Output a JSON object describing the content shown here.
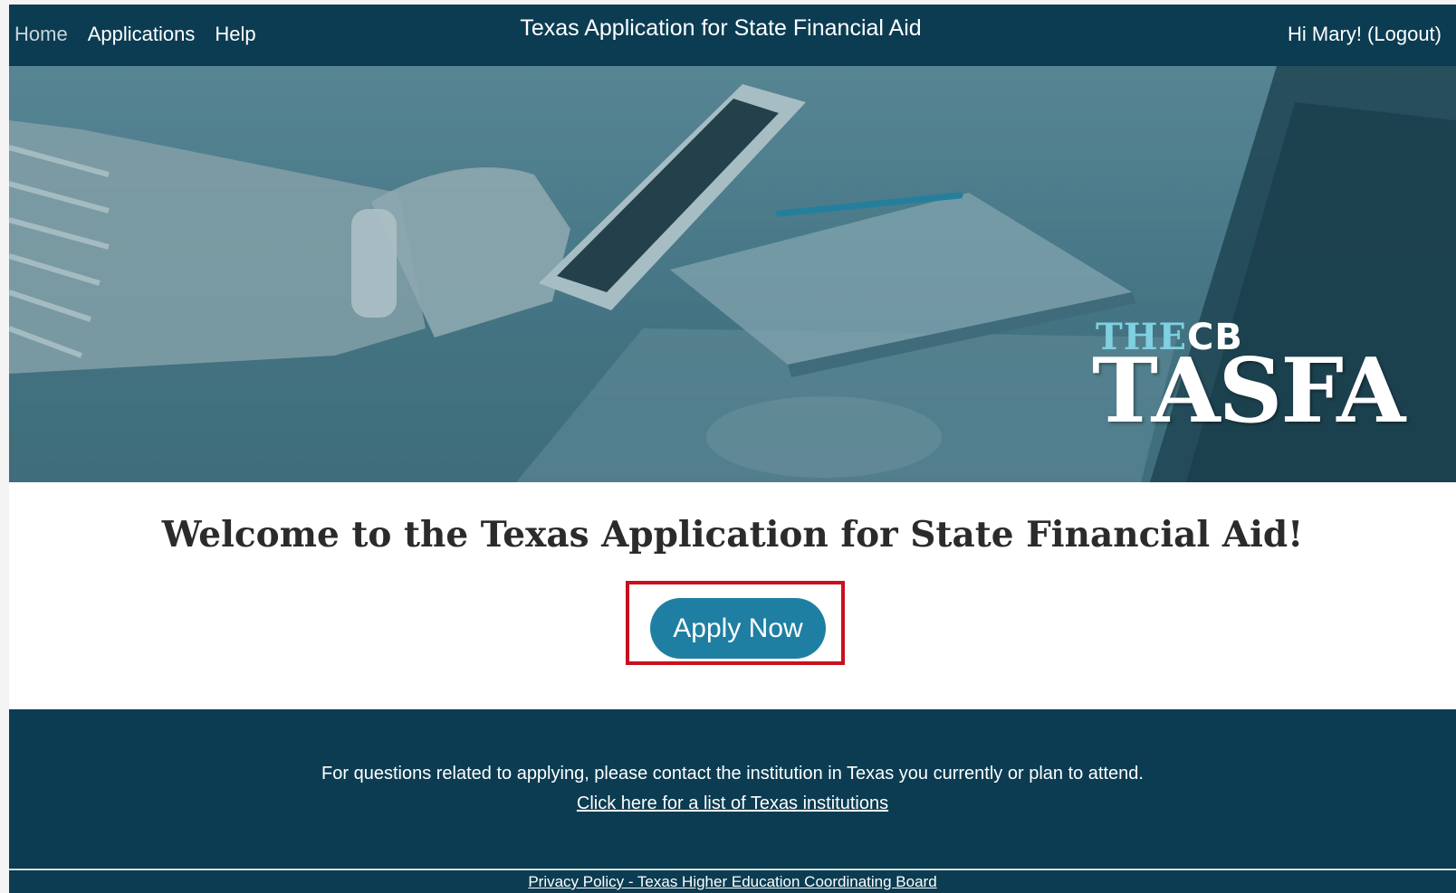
{
  "nav": {
    "home": "Home",
    "applications": "Applications",
    "help": "Help",
    "title": "Texas Application for State Financial Aid",
    "user": "Hi Mary! (Logout)"
  },
  "hero": {
    "logo_the": "THE",
    "logo_cb": "CB",
    "logo_main": "TASFA"
  },
  "main": {
    "welcome": "Welcome to the Texas Application for State Financial Aid!",
    "apply_label": "Apply Now"
  },
  "footer": {
    "question": "For questions related to applying, please contact the institution in Texas you currently or plan to attend.",
    "institutions_link": "Click here for a list of Texas institutions",
    "privacy_link": "Privacy Policy - Texas Higher Education Coordinating Board"
  },
  "colors": {
    "header_bg": "#0b3c52",
    "apply_button": "#1f7fa2",
    "highlight_frame": "#c8101e",
    "logo_accent": "#7fd0e2"
  }
}
